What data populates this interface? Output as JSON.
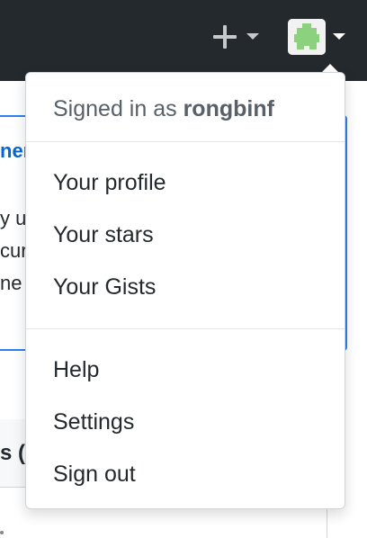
{
  "header": {
    "create_menu_icon": "plus-icon",
    "caret_icon": "triangle-down-icon",
    "avatar_icon": "identicon-avatar",
    "background_color": "#24292e"
  },
  "background_page": {
    "title_fragment": "nen",
    "lines": [
      "y us",
      "cur",
      "ne l"
    ],
    "section_fragment": "s ("
  },
  "dropdown": {
    "signed_in_prefix": "Signed in as",
    "username": "rongbinf",
    "groups": [
      {
        "items": [
          "Your profile",
          "Your stars",
          "Your Gists"
        ]
      },
      {
        "items": [
          "Help",
          "Settings",
          "Sign out"
        ]
      }
    ]
  },
  "colors": {
    "accent": "#0366d6",
    "avatar_green": "#8cd17d",
    "text": "#24292e",
    "muted": "#586069"
  }
}
